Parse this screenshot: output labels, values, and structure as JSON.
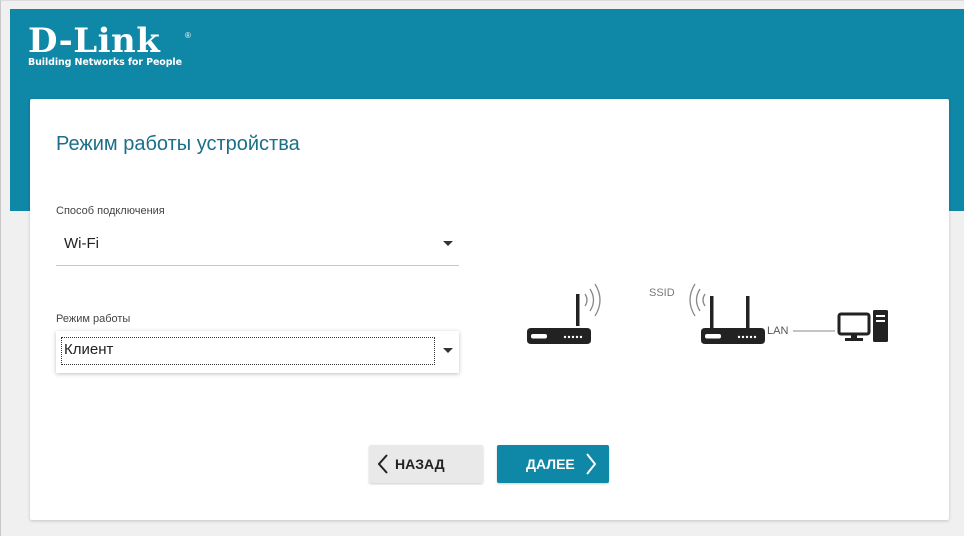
{
  "brand": {
    "name": "D-Link",
    "registered": "®",
    "tagline": "Building Networks for People",
    "color": "#0f87a6"
  },
  "page": {
    "title": "Режим работы устройства"
  },
  "connection": {
    "label": "Способ подключения",
    "value": "Wi-Fi"
  },
  "mode": {
    "label": "Режим работы",
    "value": "Клиент"
  },
  "diagram": {
    "ssid_label": "SSID",
    "lan_label": "LAN",
    "icons": [
      "router-icon",
      "router-icon",
      "computer-icon"
    ]
  },
  "buttons": {
    "back_label": "НАЗАД",
    "next_label": "ДАЛЕЕ"
  }
}
